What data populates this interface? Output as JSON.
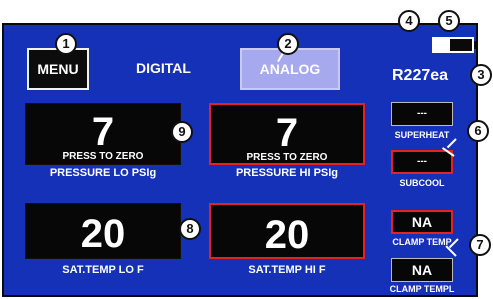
{
  "header": {
    "menu_label": "MENU",
    "digital_label": "DIGITAL",
    "analog_label": "ANALOG",
    "refrigerant": "R227ea"
  },
  "readouts": {
    "pressure_lo": {
      "value": "7",
      "prompt": "PRESS TO ZERO",
      "caption": "PRESSURE LO PSIg"
    },
    "pressure_hi": {
      "value": "7",
      "prompt": "PRESS TO ZERO",
      "caption": "PRESSURE HI PSIg"
    },
    "sat_temp_lo": {
      "value": "20",
      "caption": "SAT.TEMP LO F"
    },
    "sat_temp_hi": {
      "value": "20",
      "caption": "SAT.TEMP HI F"
    }
  },
  "side": {
    "superheat": {
      "value": "---",
      "caption": "SUPERHEAT"
    },
    "subcool": {
      "value": "---",
      "caption": "SUBCOOL"
    },
    "clamp_temp_h": {
      "value": "NA",
      "caption": "CLAMP TEMP"
    },
    "clamp_temp_l": {
      "value": "NA",
      "caption": "CLAMP TEMPL"
    }
  },
  "callouts": [
    "1",
    "2",
    "3",
    "4",
    "5",
    "6",
    "7",
    "8",
    "9"
  ],
  "colors": {
    "panel": "#1531b8",
    "readout_bg": "#070707",
    "active_border": "#e3231f",
    "analog_button": "#a7a9ef"
  }
}
